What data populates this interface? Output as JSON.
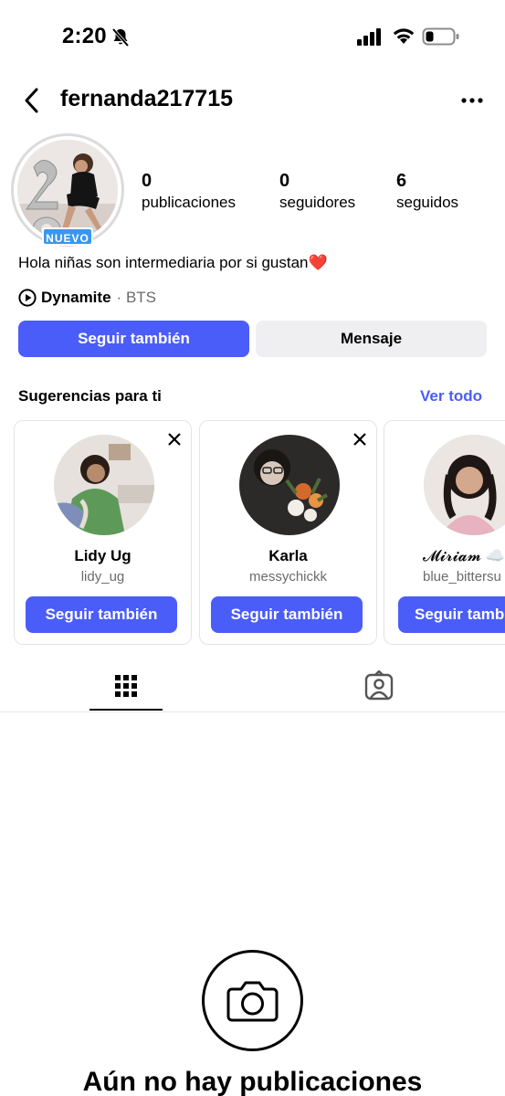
{
  "status_bar": {
    "time": "2:20"
  },
  "header": {
    "username": "fernanda217715"
  },
  "profile": {
    "badge": "NUEVO",
    "stats": [
      {
        "value": "0",
        "label": "publicaciones"
      },
      {
        "value": "0",
        "label": "seguidores"
      },
      {
        "value": "6",
        "label": "seguidos"
      }
    ],
    "bio_text": "Hola niñas son intermediaria por si gustan",
    "bio_emoji": "❤️",
    "music": {
      "song": "Dynamite",
      "separator": "·",
      "artist": "BTS"
    }
  },
  "actions": {
    "follow_label": "Seguir también",
    "message_label": "Mensaje"
  },
  "suggestions": {
    "title": "Sugerencias para ti",
    "see_all": "Ver todo",
    "cards": [
      {
        "name": "Lidy Ug",
        "handle": "lidy_ug",
        "button": "Seguir también"
      },
      {
        "name": "Karla",
        "handle": "messychickk",
        "button": "Seguir también"
      },
      {
        "name": "𝓜𝓲𝓻𝓲𝓪𝓶 ☁️",
        "handle": "blue_bittersu",
        "button": "Seguir también"
      }
    ]
  },
  "empty_state": {
    "title": "Aún no hay publicaciones"
  },
  "colors": {
    "accent": "#4a5df9",
    "badge": "#3897f0",
    "secondary_button": "#efeff2",
    "link": "#4a5df9"
  }
}
